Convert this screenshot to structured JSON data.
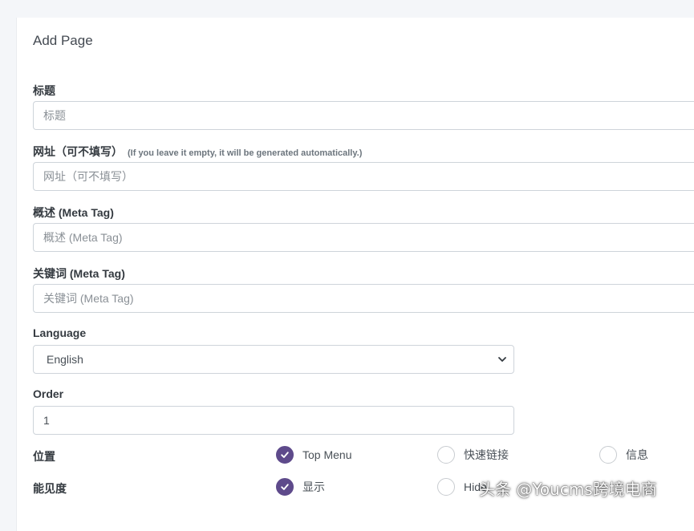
{
  "card": {
    "title": "Add Page"
  },
  "form": {
    "title": {
      "label": "标题",
      "placeholder": "标题"
    },
    "url": {
      "label": "网址（可不填写）",
      "hint": "(If you leave it empty, it will be generated automatically.)",
      "placeholder": "网址（可不填写）"
    },
    "description": {
      "label": "概述 (Meta Tag)",
      "placeholder": "概述 (Meta Tag)"
    },
    "keywords": {
      "label": "关键词 (Meta Tag)",
      "placeholder": "关键词 (Meta Tag)"
    },
    "language": {
      "label": "Language",
      "selected": "English"
    },
    "order": {
      "label": "Order",
      "value": "1"
    },
    "position": {
      "label": "位置",
      "options": [
        {
          "label": "Top Menu",
          "checked": true
        },
        {
          "label": "快速链接",
          "checked": false
        },
        {
          "label": "信息",
          "checked": false
        }
      ]
    },
    "visibility": {
      "label": "能见度",
      "options": [
        {
          "label": "显示",
          "checked": true
        },
        {
          "label": "Hide",
          "checked": false
        }
      ]
    }
  },
  "watermark": "头条 @Youcms跨境电商",
  "icons": {
    "radio_check": "check-icon",
    "select_arrow": "chevron-down-icon"
  },
  "colors": {
    "radio_checked": "#5e4a8b",
    "page_bg": "#f4f6f9",
    "border": "#ced4da"
  }
}
